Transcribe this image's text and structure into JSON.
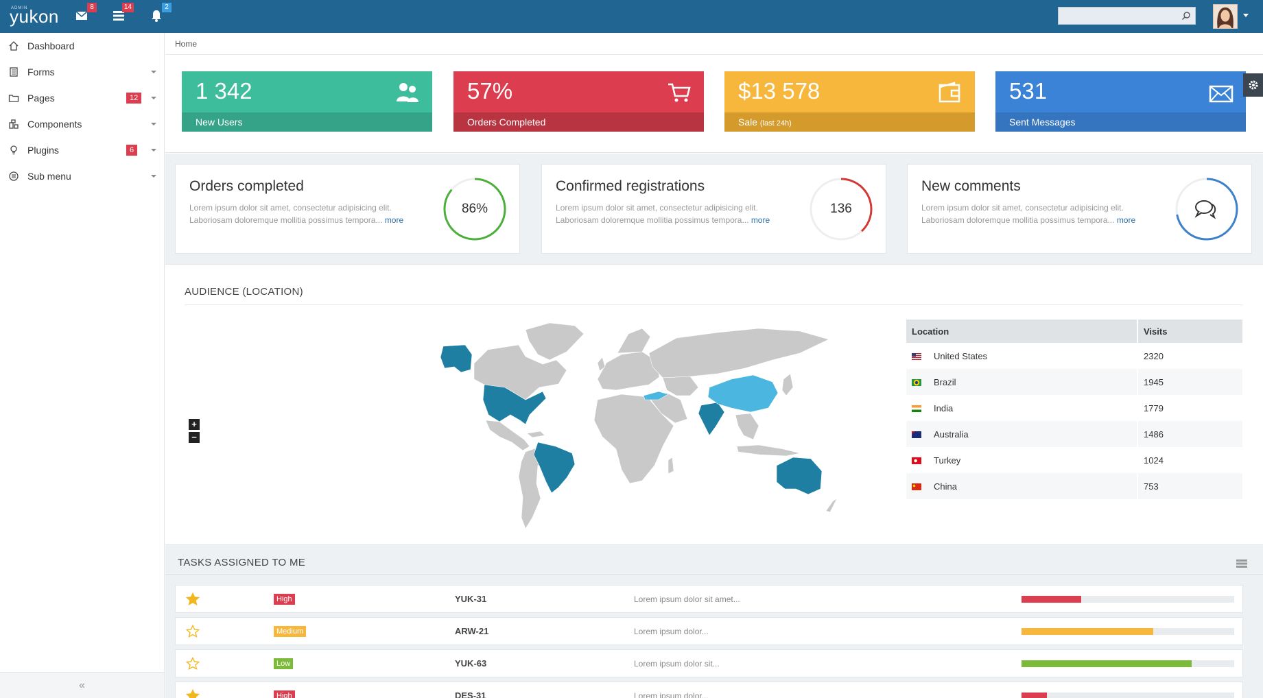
{
  "brand": {
    "small": "ADMIN",
    "name": "yukon"
  },
  "topnav": {
    "mail_badge": "8",
    "list_badge": "14",
    "bell_badge": "2",
    "search_placeholder": ""
  },
  "sidebar": {
    "items": [
      {
        "label": "Dashboard",
        "icon": "home-icon"
      },
      {
        "label": "Forms",
        "icon": "forms-icon",
        "caret": true
      },
      {
        "label": "Pages",
        "icon": "folder-icon",
        "badge": "12",
        "caret": true
      },
      {
        "label": "Components",
        "icon": "components-icon",
        "caret": true
      },
      {
        "label": "Plugins",
        "icon": "bulb-icon",
        "badge": "6",
        "caret": true
      },
      {
        "label": "Sub menu",
        "icon": "list-circle-icon",
        "caret": true
      }
    ],
    "collapse_label": "«"
  },
  "breadcrumb": {
    "home": "Home"
  },
  "stats": [
    {
      "value": "1 342",
      "label": "New Users",
      "note": "",
      "color": "#3dbd9b",
      "footer": "#35a387",
      "icon": "users-icon"
    },
    {
      "value": "57%",
      "label": "Orders Completed",
      "note": "",
      "color": "#dc3d4f",
      "footer": "#b83441",
      "icon": "cart-icon"
    },
    {
      "value": "$13 578",
      "label": "Sale",
      "note": "(last 24h)",
      "color": "#f6b73c",
      "footer": "#d49a2b",
      "icon": "wallet-icon"
    },
    {
      "value": "531",
      "label": "Sent Messages",
      "note": "",
      "color": "#3b83d6",
      "footer": "#3574bf",
      "icon": "envelope-icon"
    }
  ],
  "info_cards": [
    {
      "title": "Orders completed",
      "desc": "Lorem ipsum dolor sit amet, consectetur adipisicing elit. Laboriosam doloremque mollitia possimus tempora...",
      "more": "more",
      "ring_value": "86%",
      "ring_fraction": 0.86,
      "ring_color": "#4cae3b"
    },
    {
      "title": "Confirmed registrations",
      "desc": "Lorem ipsum dolor sit amet, consectetur adipisicing elit. Laboriosam doloremque mollitia possimus tempora...",
      "more": "more",
      "ring_value": "136",
      "ring_fraction": 0.38,
      "ring_color": "#d23a36"
    },
    {
      "title": "New comments",
      "desc": "Lorem ipsum dolor sit amet, consectetur adipisicing elit. Laboriosam doloremque mollitia possimus tempora...",
      "more": "more",
      "ring_value": "",
      "ring_fraction": 0.72,
      "ring_color": "#3e80cc",
      "ring_icon": "comments-icon"
    }
  ],
  "audience": {
    "title": "AUDIENCE (LOCATION)",
    "zoom_in": "+",
    "zoom_out": "−",
    "table": {
      "headers": [
        "Location",
        "Visits"
      ],
      "rows": [
        {
          "country": "United States",
          "visits": "2320"
        },
        {
          "country": "Brazil",
          "visits": "1945"
        },
        {
          "country": "India",
          "visits": "1779"
        },
        {
          "country": "Australia",
          "visits": "1486"
        },
        {
          "country": "Turkey",
          "visits": "1024"
        },
        {
          "country": "China",
          "visits": "753"
        }
      ]
    },
    "map_colors": {
      "land": "#c9c9c9",
      "dark": "#1e7fa3",
      "light": "#4bb6e0"
    }
  },
  "tasks": {
    "title": "TASKS ASSIGNED TO ME",
    "rows": [
      {
        "starred": true,
        "priority": "High",
        "prio_color": "#dc3d4f",
        "code": "YUK-31",
        "desc": "Lorem ipsum dolor sit amet...",
        "progress": 0.28,
        "bar_color": "#dc3d4f"
      },
      {
        "starred": false,
        "priority": "Medium",
        "prio_color": "#f6b73c",
        "code": "ARW-21",
        "desc": "Lorem ipsum dolor...",
        "progress": 0.62,
        "bar_color": "#f6b73c"
      },
      {
        "starred": false,
        "priority": "Low",
        "prio_color": "#7cba3a",
        "code": "YUK-63",
        "desc": "Lorem ipsum dolor sit...",
        "progress": 0.8,
        "bar_color": "#7cba3a"
      },
      {
        "starred": true,
        "priority": "High",
        "prio_color": "#dc3d4f",
        "code": "DES-31",
        "desc": "Lorem ipsum dolor...",
        "progress": 0.12,
        "bar_color": "#dc3d4f"
      }
    ]
  }
}
